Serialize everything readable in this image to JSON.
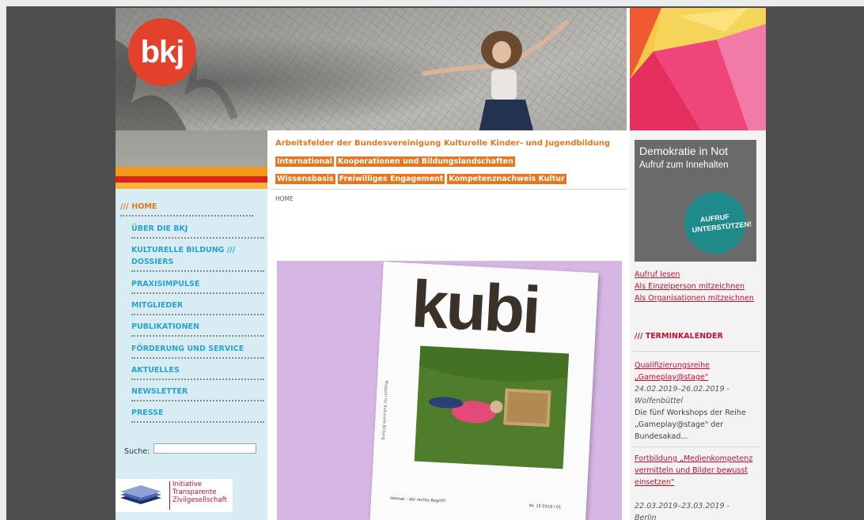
{
  "logo": {
    "text": "bkj"
  },
  "arbeitsfelder": {
    "title": "Arbeitsfelder der Bundesvereinigung Kulturelle Kinder- und Jugendbildung",
    "row1": [
      "International",
      "Kooperationen und Bildungslandschaften"
    ],
    "row2": [
      "Wissensbasis",
      "Freiwilliges Engagement",
      "Kompetenznachweis Kultur"
    ]
  },
  "nav": {
    "home_prefix": "///",
    "items": [
      "Home",
      "Über die BKJ",
      "Kulturelle Bildung /// Dossiers",
      "Praxisimpulse",
      "Mitglieder",
      "Publikationen",
      "Förderung und Service",
      "Aktuelles",
      "Newsletter",
      "Presse"
    ]
  },
  "search": {
    "label": "Suche:",
    "value": ""
  },
  "itz": {
    "line1": "Initiative",
    "line2": "Transparente",
    "line3": "Zivilgesellschaft"
  },
  "breadcrumb": "HOME",
  "magazine": {
    "title": "kubi",
    "side_text": "Magazin für Kulturelle Bildung",
    "footer_left": "Heimat – der rechte Begriff?",
    "footer_right": "Nr. 15 2019 / 01"
  },
  "demokratie": {
    "title": "Demokratie in Not",
    "subtitle": "Aufruf zum Innehalten",
    "button": "AUFRUF UNTERSTÜTZEN!"
  },
  "aufruf_links": [
    "Aufruf lesen",
    "Als Einzelperson mitzeichnen",
    "Als Organisationen mitzeichnen"
  ],
  "termin": {
    "heading": "/// TERMINKALENDER",
    "events": [
      {
        "title": "Qualifizierungsreihe „Gameplay@stage\"",
        "date": "24.02.2019–26.02.2019 -",
        "place": "Wolfenbüttel",
        "text": "Die fünf Workshops der Reihe „Gameplay@stage\" der Bundesakad..."
      },
      {
        "title": "Fortbildung „Medienkompetenz vermitteln und Bilder bewusst einsetzen\"",
        "date": "22.03.2019–23.03.2019 -",
        "place": "Berlin",
        "text": ""
      }
    ]
  },
  "colors": {
    "accent_orange": "#e8761e",
    "nav_blue": "#29a2d6",
    "link_red": "#c8102e",
    "nav_bg": "#d7edf3"
  }
}
